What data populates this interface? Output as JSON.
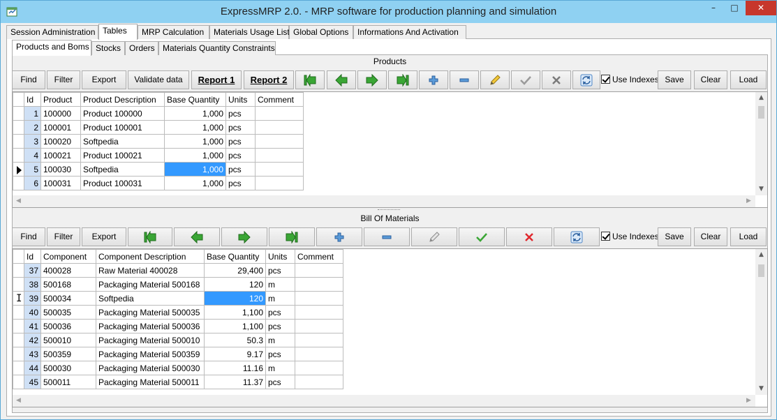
{
  "window": {
    "title": "ExpressMRP 2.0. - MRP software for production planning and simulation",
    "min_glyph": "–",
    "max_glyph": "□",
    "close_glyph": "✕"
  },
  "main_tabs": [
    "Session Administration",
    "Tables",
    "MRP Calculation",
    "Materials Usage List",
    "Global Options",
    "Informations And Activation"
  ],
  "sub_tabs": [
    "Products and Boms",
    "Stocks",
    "Orders",
    "Materials Quantity Constraints"
  ],
  "products": {
    "title": "Products",
    "toolbar": {
      "find": "Find",
      "filter": "Filter",
      "export": "Export",
      "validate": "Validate data",
      "report1": "Report 1",
      "report2": "Report 2",
      "use_indexes": "Use Indexes",
      "save": "Save",
      "clear": "Clear",
      "load": "Load"
    },
    "columns": [
      "Id",
      "Product",
      "Product Description",
      "Base Quantity",
      "Units",
      "Comment"
    ],
    "rows": [
      {
        "id": "1",
        "product": "100000",
        "desc": "Product 100000",
        "qty": "1,000",
        "units": "pcs",
        "comment": ""
      },
      {
        "id": "2",
        "product": "100001",
        "desc": "Product 100001",
        "qty": "1,000",
        "units": "pcs",
        "comment": ""
      },
      {
        "id": "3",
        "product": "100020",
        "desc": "Softpedia",
        "qty": "1,000",
        "units": "pcs",
        "comment": ""
      },
      {
        "id": "4",
        "product": "100021",
        "desc": "Product 100021",
        "qty": "1,000",
        "units": "pcs",
        "comment": ""
      },
      {
        "id": "5",
        "product": "100030",
        "desc": "Softpedia",
        "qty": "1,000",
        "units": "pcs",
        "comment": ""
      },
      {
        "id": "6",
        "product": "100031",
        "desc": "Product 100031",
        "qty": "1,000",
        "units": "pcs",
        "comment": ""
      }
    ]
  },
  "boms": {
    "title": "Bill Of Materials",
    "toolbar": {
      "find": "Find",
      "filter": "Filter",
      "export": "Export",
      "use_indexes": "Use Indexes",
      "save": "Save",
      "clear": "Clear",
      "load": "Load"
    },
    "columns": [
      "Id",
      "Component",
      "Component Description",
      "Base Quantity",
      "Units",
      "Comment"
    ],
    "rows": [
      {
        "id": "37",
        "comp": "400028",
        "desc": "Raw Material 400028",
        "qty": "29,400",
        "units": "pcs",
        "comment": ""
      },
      {
        "id": "38",
        "comp": "500168",
        "desc": "Packaging Material 500168",
        "qty": "120",
        "units": "m",
        "comment": ""
      },
      {
        "id": "39",
        "comp": "500034",
        "desc": "Softpedia",
        "qty": "120",
        "units": "m",
        "comment": ""
      },
      {
        "id": "40",
        "comp": "500035",
        "desc": "Packaging Material 500035",
        "qty": "1,100",
        "units": "pcs",
        "comment": ""
      },
      {
        "id": "41",
        "comp": "500036",
        "desc": "Packaging Material 500036",
        "qty": "1,100",
        "units": "pcs",
        "comment": ""
      },
      {
        "id": "42",
        "comp": "500010",
        "desc": "Packaging Material 500010",
        "qty": "50.3",
        "units": "m",
        "comment": ""
      },
      {
        "id": "43",
        "comp": "500359",
        "desc": "Packaging Material 500359",
        "qty": "9.17",
        "units": "pcs",
        "comment": ""
      },
      {
        "id": "44",
        "comp": "500030",
        "desc": "Packaging Material 500030",
        "qty": "11.16",
        "units": "m",
        "comment": ""
      },
      {
        "id": "45",
        "comp": "500011",
        "desc": "Packaging Material 500011",
        "qty": "11.37",
        "units": "pcs",
        "comment": ""
      }
    ]
  },
  "icons": {
    "first": "first-record-icon",
    "prev": "previous-record-icon",
    "next": "next-record-icon",
    "last": "last-record-icon",
    "add": "add-icon",
    "remove": "remove-icon",
    "edit": "edit-pencil-icon",
    "post": "confirm-check-icon",
    "cancel": "cancel-x-icon",
    "refresh": "refresh-icon"
  },
  "colors": {
    "titlebar": "#8fd1f2",
    "selection": "#3399ff",
    "id_column": "#cfe0f5",
    "close": "#c7372c",
    "nav_green": "#3aa635"
  }
}
